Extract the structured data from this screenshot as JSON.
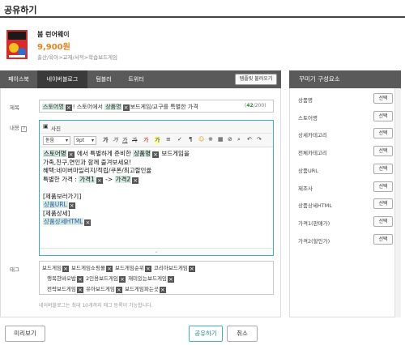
{
  "page_title": "공유하기",
  "product": {
    "name": "붐 런어웨이",
    "price": "9,900원",
    "category": "출산/육아>교재/서적>학습보드게임"
  },
  "tabs": [
    {
      "label": "페이스북"
    },
    {
      "label": "네이버블로그"
    },
    {
      "label": "텀블러"
    },
    {
      "label": "트위터"
    }
  ],
  "load_template_label": "템플릿 불러오기",
  "form": {
    "subject_label": "제목",
    "subject_tag_1": "스토어명",
    "subject_text_1": "! 스토어에서",
    "subject_tag_2": "상품명",
    "subject_text_2": "보드게임/교구를 특별한 가격",
    "subject_count": "42",
    "subject_max": "/200)",
    "subject_open": "(",
    "content_label": "내용",
    "help_mark": "?",
    "photo_label": "사진",
    "font_select": "돋움",
    "size_select": "9pt"
  },
  "editor_body": {
    "l1_tag1": "스토어명",
    "l1_mid": "에서 특별하게 준비한",
    "l1_tag2": "상품명",
    "l1_tail": "보드게임을",
    "l2": "가족,친구,연인과 함께 즐겨보세요!",
    "l3": "혜택:네이버마일리지/적립/쿠폰/최고할인율",
    "l4_pre": "특별한 가격 :",
    "l4_tag1": "가격1",
    "l4_arrow": "->",
    "l4_tag2": "가격2",
    "l5": "[제품보러가기]",
    "l6_tag": "상품URL",
    "l7": "[제품상세]",
    "l8_tag": "상품상세HTML"
  },
  "tag_label": "태그",
  "tags_row1": [
    "보드게임",
    "보드게임쇼핑몰",
    "보드게임순위",
    "코리아보드게임"
  ],
  "tags_row2": [
    "행복한바오밥",
    "2인용보드게임",
    "재미있는보드게임"
  ],
  "tags_row3": [
    "전략보드게임",
    "유아보드게임",
    "보드게임파는곳"
  ],
  "tag_note": "네이버블로그는 최대 10개까지 태그 등록이 가능합니다.",
  "sidebar": {
    "title": "꾸미기 구성요소",
    "select_label": "선택",
    "items": [
      {
        "label": "상품명"
      },
      {
        "label": "스토어명"
      },
      {
        "label": "상세카테고리"
      },
      {
        "label": "전체카테고리"
      },
      {
        "label": "상품URL"
      },
      {
        "label": "제조사"
      },
      {
        "label": "상품상세HTML"
      },
      {
        "label": "가격1(판매가)"
      },
      {
        "label": "가격2(할인가)"
      }
    ]
  },
  "buttons": {
    "preview": "미리보기",
    "share": "공유하기",
    "cancel": "취소"
  },
  "colors": {
    "accent": "#3cb0bf",
    "price": "#e8841d",
    "tabbar": "#5a5a5a",
    "tag_highlight": "#d4eae0"
  }
}
